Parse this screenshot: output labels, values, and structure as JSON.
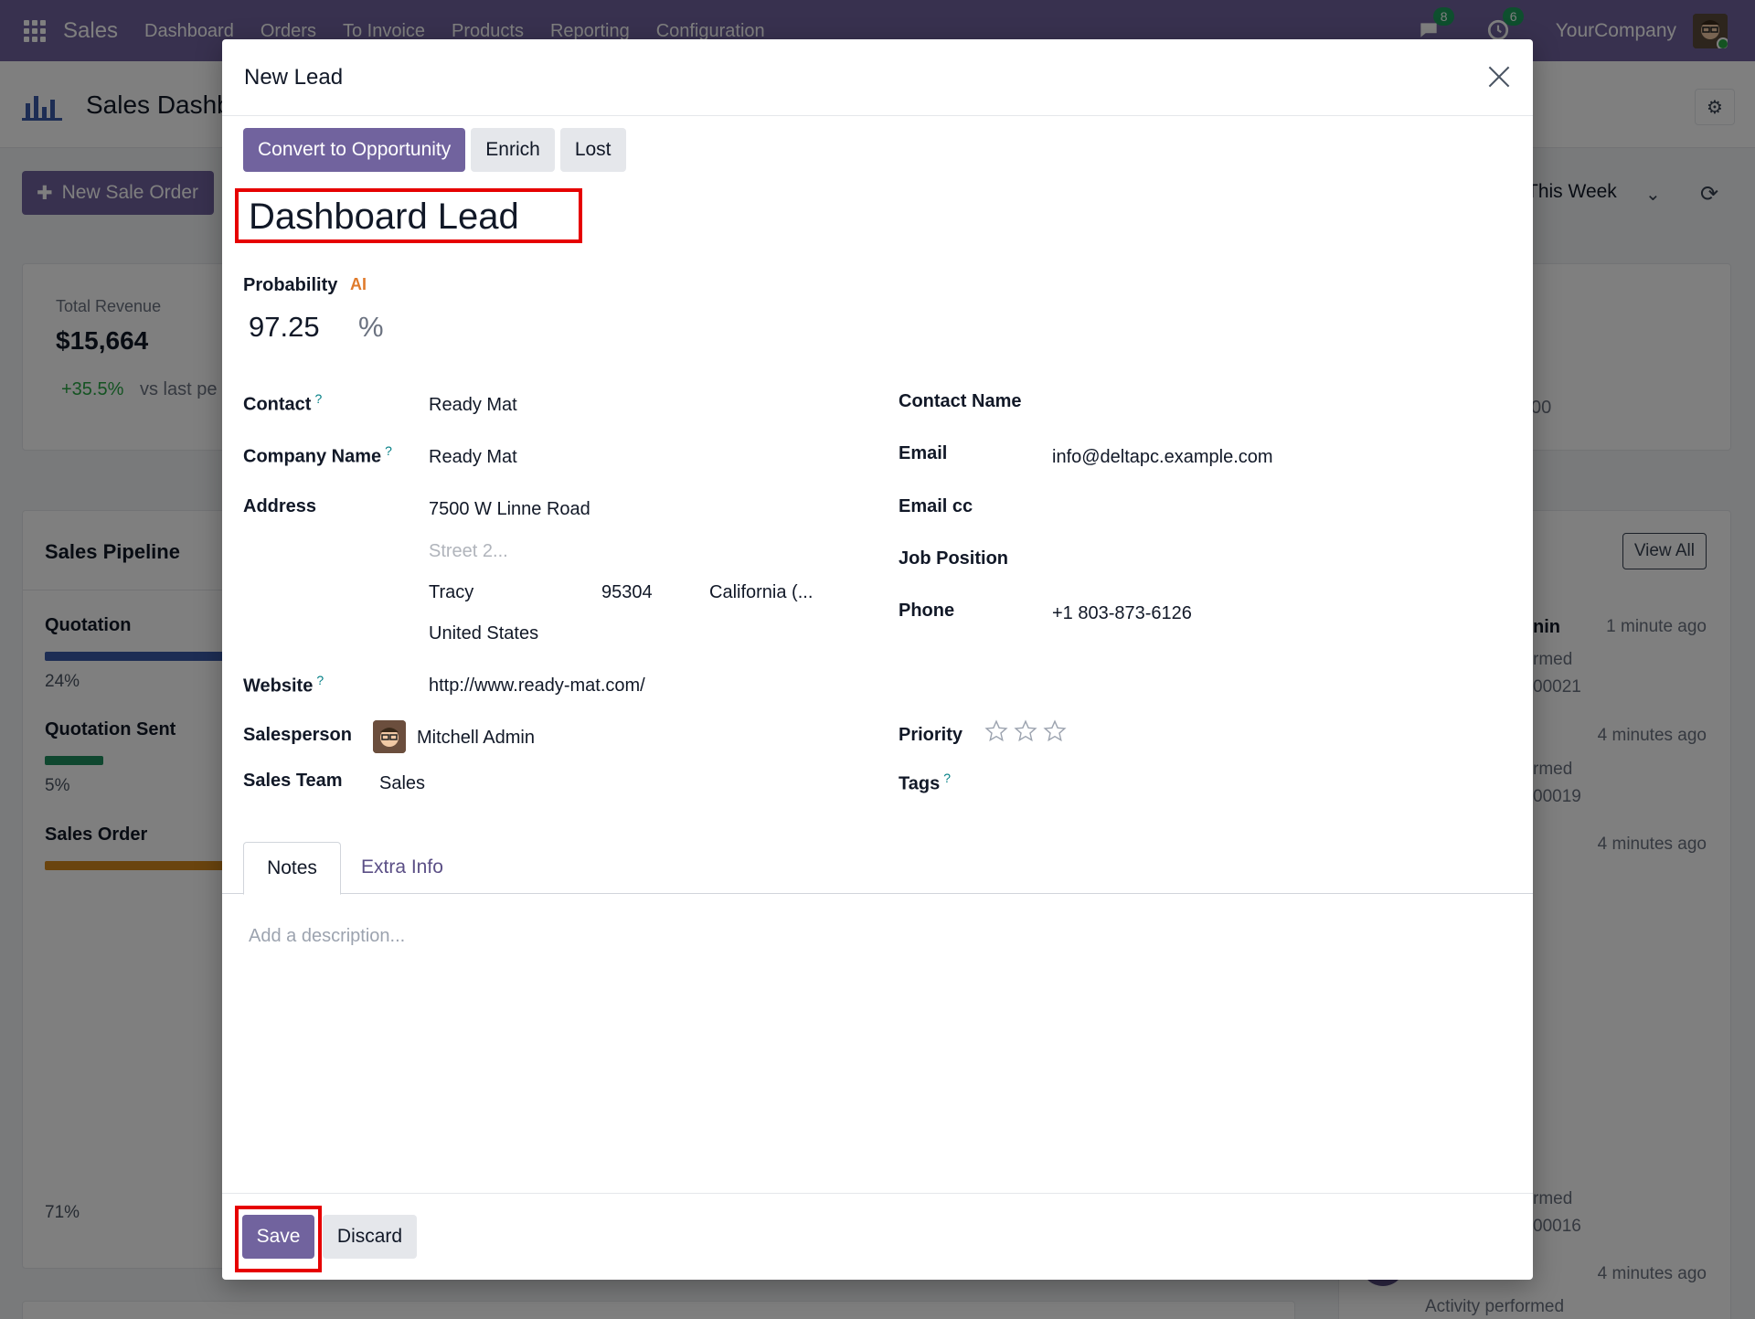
{
  "navbar": {
    "app_name": "Sales",
    "menu": [
      "Dashboard",
      "Orders",
      "To Invoice",
      "Products",
      "Reporting",
      "Configuration"
    ],
    "messages_count": "8",
    "activities_count": "6",
    "company": "YourCompany"
  },
  "background": {
    "page_title": "Sales Dashb",
    "new_order_label": "New Sale Order",
    "period": "This Week",
    "revenue_label": "Total Revenue",
    "revenue_value": "$15,664",
    "revenue_delta": "+35.5%",
    "revenue_sub": "vs last pe",
    "revenue_right": "00",
    "pipeline_title": "Sales Pipeline",
    "stages": [
      {
        "name": "Quotation",
        "pct": "24%",
        "color": "#3b5ba9"
      },
      {
        "name": "Quotation Sent",
        "pct": "5%",
        "color": "#1f8f5f"
      },
      {
        "name": "Sales Order",
        "pct": "71%",
        "color": "#d4881c"
      }
    ],
    "view_all": "View All",
    "activity": {
      "item1_title": "nin",
      "item1_time": "1 minute ago",
      "item1_line1": "rmed",
      "item1_line2": "00021",
      "item2_time": "4 minutes ago",
      "item2_line1": "rmed",
      "item2_line2": "00019",
      "item3_time": "4 minutes ago",
      "item4_line1": "rmed",
      "item4_line2": "00016",
      "item5_time": "4 minutes ago",
      "item5_line": "Activity performed"
    }
  },
  "modal": {
    "title": "New Lead",
    "actions": {
      "convert": "Convert to Opportunity",
      "enrich": "Enrich",
      "lost": "Lost"
    },
    "lead_name": "Dashboard Lead",
    "probability_label": "Probability",
    "ai_badge": "AI",
    "probability_value": "97.25",
    "probability_unit": "%",
    "help_mark": "?",
    "fields": {
      "contact_label": "Contact",
      "contact_value": "Ready Mat",
      "company_label": "Company Name",
      "company_value": "Ready Mat",
      "address_label": "Address",
      "street": "7500 W Linne Road",
      "street2_placeholder": "Street 2...",
      "city": "Tracy",
      "zip": "95304",
      "state": "California (...",
      "country": "United States",
      "website_label": "Website",
      "website_value": "http://www.ready-mat.com/",
      "salesperson_label": "Salesperson",
      "salesperson_value": "Mitchell Admin",
      "team_label": "Sales Team",
      "team_value": "Sales",
      "contact_name_label": "Contact Name",
      "email_label": "Email",
      "email_value": "info@deltapc.example.com",
      "email_cc_label": "Email cc",
      "job_position_label": "Job Position",
      "phone_label": "Phone",
      "phone_value": "+1 803-873-6126",
      "priority_label": "Priority",
      "priority_stars": 0,
      "priority_max": 3,
      "tags_label": "Tags"
    },
    "tabs": [
      "Notes",
      "Extra Info"
    ],
    "description_placeholder": "Add a description...",
    "footer": {
      "save": "Save",
      "discard": "Discard"
    }
  }
}
